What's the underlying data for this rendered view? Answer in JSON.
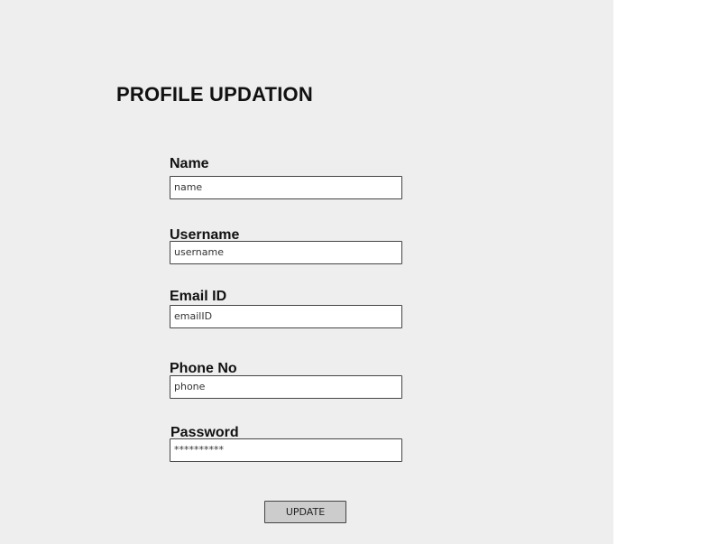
{
  "form": {
    "title": "PROFILE UPDATION",
    "fields": [
      {
        "label": "Name",
        "value": "name"
      },
      {
        "label": "Username",
        "value": "username"
      },
      {
        "label": "Email ID",
        "value": "emailID"
      },
      {
        "label": "Phone No",
        "value": "phone"
      },
      {
        "label": "Password",
        "value": "**********"
      }
    ],
    "update_label": "UPDATE"
  },
  "colors": {
    "panel_background": "#eeeeee",
    "page_background": "#ffffff",
    "button_background": "#cccccc"
  }
}
